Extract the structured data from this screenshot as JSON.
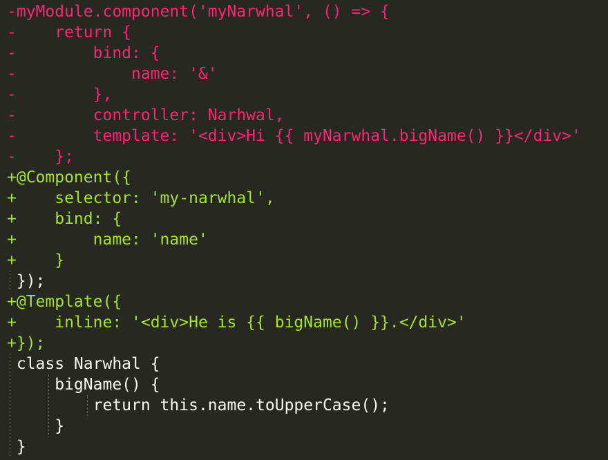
{
  "diff": {
    "lines": [
      {
        "type": "removed",
        "text": "-myModule.component('myNarwhal', () => {"
      },
      {
        "type": "removed",
        "text": "-    return {"
      },
      {
        "type": "removed",
        "text": "-        bind: {"
      },
      {
        "type": "removed",
        "text": "-            name: '&'"
      },
      {
        "type": "removed",
        "text": "-        },"
      },
      {
        "type": "removed",
        "text": "-        controller: Narhwal,"
      },
      {
        "type": "removed",
        "text": "-        template: '<div>Hi {{ myNarwhal.bigName() }}</div>'"
      },
      {
        "type": "removed",
        "text": "-    };"
      },
      {
        "type": "added",
        "text": "+@Component({"
      },
      {
        "type": "added",
        "text": "+    selector: 'my-narwhal',"
      },
      {
        "type": "added",
        "text": "+    bind: {"
      },
      {
        "type": "added",
        "text": "+        name: 'name'"
      },
      {
        "type": "added",
        "text": "+    }"
      },
      {
        "type": "context",
        "text": " });"
      },
      {
        "type": "added",
        "text": "+@Template({"
      },
      {
        "type": "added",
        "text": "+    inline: '<div>He is {{ bigName() }}.</div>'"
      },
      {
        "type": "added",
        "text": "+});"
      },
      {
        "type": "context",
        "text": " class Narwhal {"
      },
      {
        "type": "context",
        "text": "     bigName() {"
      },
      {
        "type": "context",
        "text": "         return this.name.toUpperCase();"
      },
      {
        "type": "context",
        "text": "     }"
      },
      {
        "type": "context",
        "text": " }"
      }
    ]
  },
  "colors": {
    "background": "#272822",
    "removed": "#f92672",
    "added": "#a6e22e",
    "context": "#f8f8f2"
  }
}
